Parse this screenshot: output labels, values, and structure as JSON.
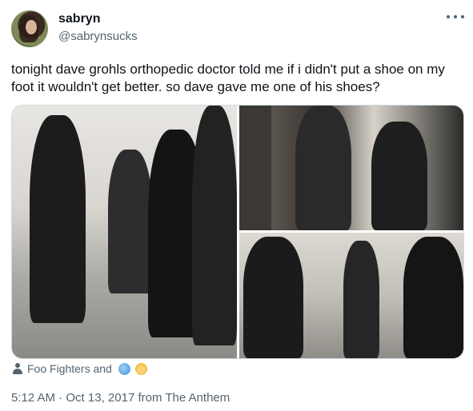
{
  "author": {
    "display_name": "sabryn",
    "handle": "@sabrynsucks",
    "avatar_icon": "profile-photo"
  },
  "more_icon": "more-horizontal-icon",
  "tweet": {
    "text": "tonight dave grohls orthopedic doctor told me if i didn't put a shoe on my foot it wouldn't get better. so dave gave me one of his shoes?"
  },
  "media": {
    "photo_count": 3
  },
  "tagged": {
    "label": "Foo Fighters and",
    "icons": [
      "globe-emoji",
      "baby-angel-emoji"
    ]
  },
  "meta": {
    "time": "5:12 AM",
    "separator": "·",
    "date": "Oct 13, 2017",
    "source": "from The Anthem"
  },
  "colors": {
    "text_primary": "#0f1419",
    "text_secondary": "#536471",
    "border": "#cfd9de"
  }
}
